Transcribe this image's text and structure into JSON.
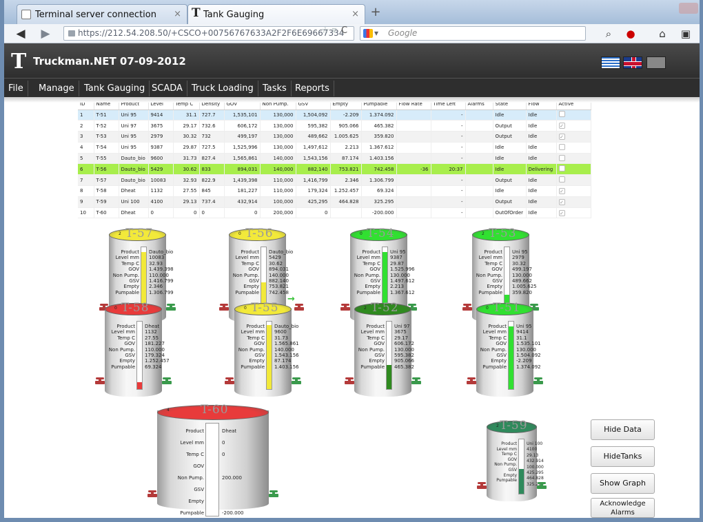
{
  "browser": {
    "tabs": [
      {
        "label": "Terminal server connection",
        "close": "×"
      },
      {
        "label": "Tank Gauging",
        "close": "×"
      }
    ],
    "new_tab": "+",
    "url_host": "https://212.54.208.50/",
    "url_path": "+CSCO+00756767633A2F2F6E69667334",
    "search_placeholder": "Google"
  },
  "app": {
    "title": "Truckman.NET  07-09-2012",
    "menu": [
      "File",
      "Manage",
      "Tank Gauging",
      "SCADA",
      "Truck Loading",
      "Tasks",
      "Reports"
    ]
  },
  "grid": {
    "columns": [
      "ID",
      "Name",
      "Product",
      "Level",
      "Temp C",
      "Density",
      "GOV",
      "Non Pump.",
      "GSV",
      "Empty",
      "Pumpable",
      "Flow Rate",
      "Time Left",
      "Alarms",
      "State",
      "Flow",
      "Active"
    ],
    "rows": [
      {
        "id": "1",
        "name": "T-51",
        "product": "Uni 95",
        "level": "9414",
        "temp": "31.1",
        "density": "727.7",
        "gov": "1,535,101",
        "nonpump": "130,000",
        "gsv": "1,504,092",
        "empty": "-2.209",
        "pumpable": "1.374.092",
        "flowrate": "",
        "timeleft": "-",
        "alarms": "",
        "state": "Idle",
        "flow": "Idle",
        "active": false,
        "style": "sel"
      },
      {
        "id": "2",
        "name": "T-52",
        "product": "Uni 97",
        "level": "3675",
        "temp": "29.17",
        "density": "732.6",
        "gov": "606,172",
        "nonpump": "130,000",
        "gsv": "595,382",
        "empty": "905.066",
        "pumpable": "465.382",
        "flowrate": "",
        "timeleft": "-",
        "alarms": "",
        "state": "Output",
        "flow": "Idle",
        "active": true,
        "style": ""
      },
      {
        "id": "3",
        "name": "T-53",
        "product": "Uni 95",
        "level": "2979",
        "temp": "30.32",
        "density": "732",
        "gov": "499,197",
        "nonpump": "130,000",
        "gsv": "489,662",
        "empty": "1.005.625",
        "pumpable": "359.820",
        "flowrate": "",
        "timeleft": "-",
        "alarms": "",
        "state": "Output",
        "flow": "Idle",
        "active": true,
        "style": "alt"
      },
      {
        "id": "4",
        "name": "T-54",
        "product": "Uni 95",
        "level": "9387",
        "temp": "29.87",
        "density": "727.5",
        "gov": "1,525,996",
        "nonpump": "130,000",
        "gsv": "1,497,612",
        "empty": "2.213",
        "pumpable": "1.367.612",
        "flowrate": "",
        "timeleft": "-",
        "alarms": "",
        "state": "Idle",
        "flow": "Idle",
        "active": false,
        "style": ""
      },
      {
        "id": "5",
        "name": "T-55",
        "product": "Dauto_bio",
        "level": "9600",
        "temp": "31.73",
        "density": "827.4",
        "gov": "1,565,861",
        "nonpump": "140,000",
        "gsv": "1,543,156",
        "empty": "87.174",
        "pumpable": "1.403.156",
        "flowrate": "",
        "timeleft": "-",
        "alarms": "",
        "state": "Idle",
        "flow": "Idle",
        "active": false,
        "style": "alt"
      },
      {
        "id": "6",
        "name": "T-56",
        "product": "Dauto_bio",
        "level": "5429",
        "temp": "30.62",
        "density": "833",
        "gov": "894,031",
        "nonpump": "140,000",
        "gsv": "882,140",
        "empty": "753.821",
        "pumpable": "742.458",
        "flowrate": "-36",
        "timeleft": "20:37",
        "alarms": "",
        "state": "Idle",
        "flow": "Delivering",
        "active": false,
        "style": "hl"
      },
      {
        "id": "7",
        "name": "T-57",
        "product": "Dauto_bio",
        "level": "10083",
        "temp": "32.93",
        "density": "822.9",
        "gov": "1,439,398",
        "nonpump": "110,000",
        "gsv": "1,416,799",
        "empty": "2.346",
        "pumpable": "1.306.799",
        "flowrate": "",
        "timeleft": "-",
        "alarms": "",
        "state": "Output",
        "flow": "Idle",
        "active": false,
        "style": "alt"
      },
      {
        "id": "8",
        "name": "T-58",
        "product": "Dheat",
        "level": "1132",
        "temp": "27.55",
        "density": "845",
        "gov": "181,227",
        "nonpump": "110,000",
        "gsv": "179,324",
        "empty": "1.252.457",
        "pumpable": "69.324",
        "flowrate": "",
        "timeleft": "-",
        "alarms": "",
        "state": "Idle",
        "flow": "Idle",
        "active": true,
        "style": ""
      },
      {
        "id": "9",
        "name": "T-59",
        "product": "Uni 100",
        "level": "4100",
        "temp": "29.13",
        "density": "737.4",
        "gov": "432,914",
        "nonpump": "100,000",
        "gsv": "425,295",
        "empty": "464.828",
        "pumpable": "325.295",
        "flowrate": "",
        "timeleft": "-",
        "alarms": "",
        "state": "Output",
        "flow": "Idle",
        "active": true,
        "style": "alt"
      },
      {
        "id": "10",
        "name": "T-60",
        "product": "Dheat",
        "level": "0",
        "temp": "0",
        "density": "0",
        "gov": "0",
        "nonpump": "200,000",
        "gsv": "0",
        "empty": "",
        "pumpable": "-200.000",
        "flowrate": "",
        "timeleft": "-",
        "alarms": "",
        "state": "OutOfOrder",
        "flow": "Idle",
        "active": true,
        "style": ""
      }
    ]
  },
  "tank_labels": [
    "Product",
    "Level mm",
    "Temp C",
    "GOV",
    "Non Pump.",
    "GSV",
    "Empty",
    "Pumpable"
  ],
  "tanks": [
    {
      "name": "T-57",
      "num": "2",
      "cap": "#f2e93a",
      "fill": "#f2e93a",
      "level": 0.93,
      "values": [
        "Dauto_bio",
        "10083",
        "32.93",
        "1.439.398",
        "110.000",
        "1.416.799",
        "2.346",
        "1.306.799"
      ],
      "arrow": ""
    },
    {
      "name": "T-56",
      "num": "0",
      "cap": "#f2e93a",
      "fill": "#f2e93a",
      "level": 0.49,
      "values": [
        "Dauto_bio",
        "5429",
        "30.62",
        "894.031",
        "140.000",
        "882.140",
        "753.821",
        "742.458"
      ],
      "arrow": "→"
    },
    {
      "name": "T-54",
      "num": "0",
      "cap": "#31e031",
      "fill": "#31e031",
      "level": 0.93,
      "values": [
        "Uni 95",
        "9387",
        "29.87",
        "1.525.996",
        "130.000",
        "1.497.612",
        "2.213",
        "1.367.612"
      ],
      "arrow": ""
    },
    {
      "name": "T-53",
      "num": "2",
      "cap": "#31e031",
      "fill": "#31e031",
      "level": 0.3,
      "values": [
        "Uni 95",
        "2979",
        "30.32",
        "499.197",
        "130.000",
        "489.662",
        "1.005.625",
        "359.820"
      ],
      "arrow": ""
    },
    {
      "name": "T-58",
      "num": "0",
      "cap": "#e83b3b",
      "fill": "#e83b3b",
      "level": 0.1,
      "values": [
        "Dheat",
        "1132",
        "27.55",
        "181.227",
        "110.000",
        "179.324",
        "1.252.457",
        "69.324"
      ],
      "arrow": ""
    },
    {
      "name": "T-55",
      "num": "0",
      "cap": "#f2e93a",
      "fill": "#f2e93a",
      "level": 0.95,
      "values": [
        "Dauto_bio",
        "9600",
        "31.73",
        "1.565.861",
        "140.000",
        "1.543.156",
        "87.174",
        "1.403.156"
      ],
      "arrow": ""
    },
    {
      "name": "T-52",
      "num": "2",
      "cap": "#2f8a1f",
      "fill": "#2f8a1f",
      "level": 0.36,
      "values": [
        "Uni 97",
        "3675",
        "29.17",
        "606.172",
        "130.000",
        "595.382",
        "905.066",
        "465.382"
      ],
      "arrow": ""
    },
    {
      "name": "T-51",
      "num": "0",
      "cap": "#31e031",
      "fill": "#31e031",
      "level": 0.93,
      "values": [
        "Uni 95",
        "9414",
        "31.1",
        "1.535.101",
        "130.000",
        "1.504.092",
        "-2.209",
        "1.374.092"
      ],
      "arrow": ""
    },
    {
      "name": "T-60",
      "num": "4",
      "cap": "#e83b3b",
      "fill": "#e83b3b",
      "level": 0,
      "values": [
        "Dheat",
        "0",
        "0",
        "",
        "200.000",
        "",
        "",
        "-200.000"
      ],
      "arrow": ""
    },
    {
      "name": "T-59",
      "num": "2",
      "cap": "#2f8a5c",
      "fill": "#2f8a5c",
      "level": 0.45,
      "values": [
        "Uni 100",
        "4100",
        "29.13",
        "432.914",
        "100.000",
        "425.295",
        "464.828",
        "325.295"
      ],
      "arrow": ""
    }
  ],
  "buttons": {
    "hide_data": "Hide Data",
    "hide_tanks": "HideTanks",
    "show_graph": "Show Graph",
    "ack_alarms": "Acknowledge Alarms"
  }
}
